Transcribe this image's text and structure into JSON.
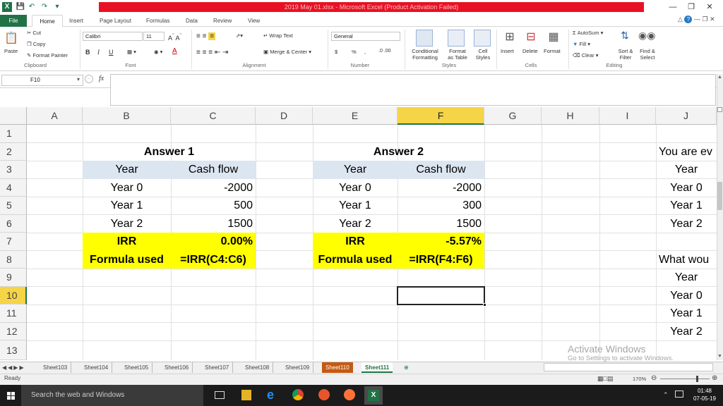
{
  "window": {
    "title": "2019 May 01.xlsx - Microsoft Excel (Product Activation Failed)"
  },
  "ribbon_tabs": [
    "File",
    "Home",
    "Insert",
    "Page Layout",
    "Formulas",
    "Data",
    "Review",
    "View"
  ],
  "ribbon": {
    "clipboard": {
      "cut": "Cut",
      "copy": "Copy",
      "paste": "Paste",
      "format_painter": "Format Painter",
      "group": "Clipboard"
    },
    "font": {
      "name": "Calibri",
      "size": "11",
      "bold": "B",
      "italic": "I",
      "underline": "U",
      "group": "Font"
    },
    "alignment": {
      "wrap_text": "Wrap Text",
      "merge_center": "Merge & Center",
      "group": "Alignment"
    },
    "number": {
      "format": "General",
      "currency": "$",
      "percent": "%",
      "comma": ",",
      "group": "Number"
    },
    "styles": {
      "conditional": "Conditional",
      "formatting": "Formatting",
      "format_as": "Format",
      "as_table": "as Table",
      "cell": "Cell",
      "cell_styles": "Styles",
      "group": "Styles"
    },
    "cells": {
      "insert": "Insert",
      "delete": "Delete",
      "format": "Format",
      "group": "Cells"
    },
    "editing": {
      "autosum": "AutoSum",
      "fill": "Fill",
      "clear": "Clear",
      "sort": "Sort &",
      "filter": "Filter",
      "find": "Find &",
      "select": "Select",
      "group": "Editing"
    }
  },
  "formula_bar": {
    "name_box": "F10",
    "fx": "fx",
    "formula": ""
  },
  "columns": [
    "A",
    "B",
    "C",
    "D",
    "E",
    "F",
    "G",
    "H",
    "I",
    "J"
  ],
  "rows": [
    "1",
    "2",
    "3",
    "4",
    "5",
    "6",
    "7",
    "8",
    "9",
    "10",
    "11",
    "12",
    "13"
  ],
  "answer1": {
    "title": "Answer 1",
    "headers": [
      "Year",
      "Cash flow"
    ],
    "rows": [
      [
        "Year 0",
        "-2000"
      ],
      [
        "Year 1",
        "500"
      ],
      [
        "Year 2",
        "1500"
      ]
    ],
    "irr_label": "IRR",
    "irr_value": "0.00%",
    "formula_label": "Formula used",
    "formula": "=IRR(C4:C6)"
  },
  "answer2": {
    "title": "Answer 2",
    "headers": [
      "Year",
      "Cash flow"
    ],
    "rows": [
      [
        "Year 0",
        "-2000"
      ],
      [
        "Year 1",
        "300"
      ],
      [
        "Year 2",
        "1500"
      ]
    ],
    "irr_label": "IRR",
    "irr_value": "-5.57%",
    "formula_label": "Formula used",
    "formula": "=IRR(F4:F6)"
  },
  "col_j": {
    "r2": "You are ev",
    "r3": "Year",
    "r4": "Year 0",
    "r5": "Year 1",
    "r6": "Year 2",
    "r8": "What wou",
    "r9": "Year",
    "r10": "Year 0",
    "r11": "Year 1",
    "r12": "Year 2"
  },
  "sheets": [
    "Sheet103",
    "Sheet104",
    "Sheet105",
    "Sheet106",
    "Sheet107",
    "Sheet108",
    "Sheet109",
    "Sheet110",
    "Sheet111"
  ],
  "active_sheet": "Sheet111",
  "status": {
    "ready": "Ready",
    "zoom": "170%"
  },
  "watermark": {
    "line1": "Activate Windows",
    "line2": "Go to Settings to activate Windows."
  },
  "taskbar": {
    "search": "Search the web and Windows",
    "time": "01:48",
    "date": "07-05-19"
  },
  "colors": {
    "excel_green": "#217346",
    "title_red": "#e81123",
    "header_blue": "#dce6f1",
    "highlight_yellow": "#ffff00"
  }
}
